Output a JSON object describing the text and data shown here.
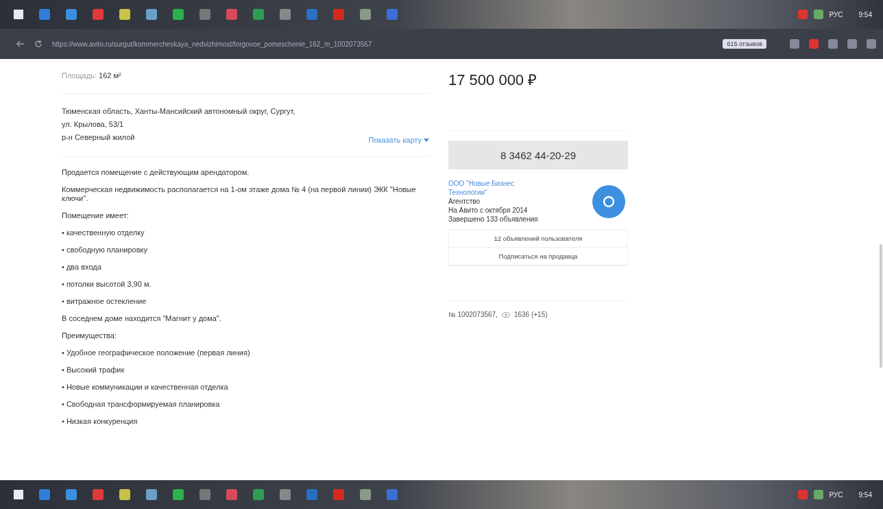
{
  "taskbar_top": {
    "language": "РУС",
    "time": "9:54"
  },
  "browser": {
    "url": "https://www.avito.ru/surgut/kommercheskaya_nedvizhimost/torgovoe_pomeschenie_162_m_1002073567",
    "reviews_badge": "615 отзывов"
  },
  "listing": {
    "area_label": "Площадь:",
    "area_value": "162 м²",
    "address_lines": [
      "Тюменская область, Ханты-Мансийский автономный округ, Сургут,",
      "ул. Крылова, 53/1",
      "р-н Северный жилой"
    ],
    "map_link": "Показать карту",
    "description": [
      "Продается помещение с действующим арендатором.",
      "Коммерческая недвижимость располагается на 1-ом этаже дома № 4 (на первой линии) ЭКК \"Новые ключи\".",
      "Помещение имеет:",
      "• качественную отделку",
      "• свободную планировку",
      "• два входа",
      "• потолки высотой 3,90 м.",
      "• витражное остекление",
      "В соседнем доме находится \"Магнит у дома\".",
      "Преимущества:",
      "• Удобное географическое положение (первая линия)",
      "• Высокий трафик",
      "• Новые коммуникации и качественная отделка",
      "• Свободная трансформируемая планировка",
      "• Низкая конкуренция"
    ]
  },
  "sidebar": {
    "price": "17 500 000 ₽",
    "phone": "8 3462 44-20-29",
    "seller": {
      "name": "ООО \"Новые Бизнес Технологии\"",
      "type": "Агентство",
      "since": "На Авито с октября 2014",
      "completed": "Завершено 133 объявления"
    },
    "seller_buttons": [
      "12 объявлений пользователя",
      "Подписаться на продавца"
    ],
    "ad_number": "№ 1002073567,",
    "views": "1636 (+15)"
  },
  "taskbar_bottom": {
    "language": "РУС",
    "time": "9:54"
  }
}
